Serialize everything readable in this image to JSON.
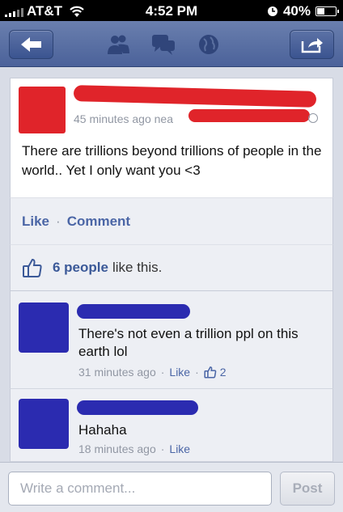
{
  "status_bar": {
    "carrier": "AT&T",
    "time": "4:52 PM",
    "battery": "40%",
    "battery_level": 0.4
  },
  "nav": {
    "icons": [
      "back-arrow-icon",
      "friend-requests-icon",
      "messages-icon",
      "notifications-globe-icon",
      "share-icon"
    ]
  },
  "post": {
    "meta": "45 minutes ago nea",
    "text": "There are trillions beyond trillions of people in the world.. Yet I only want you <3",
    "like_label": "Like",
    "separator": "·",
    "comment_label": "Comment",
    "likes_count": "6 people",
    "likes_suffix": "like this."
  },
  "comments": [
    {
      "text": "There's not even a trillion ppl on this earth lol",
      "time": "31 minutes ago",
      "sep": "·",
      "like_label": "Like",
      "likes": "2"
    },
    {
      "text": "Hahaha",
      "time": "18 minutes ago",
      "sep": "·",
      "like_label": "Like"
    }
  ],
  "composer": {
    "placeholder": "Write a comment...",
    "post_label": "Post"
  },
  "colors": {
    "nav": "#4b629a",
    "link": "#4b66a6",
    "redaction_red": "#e0242a",
    "redaction_blue": "#2b2bb0"
  }
}
